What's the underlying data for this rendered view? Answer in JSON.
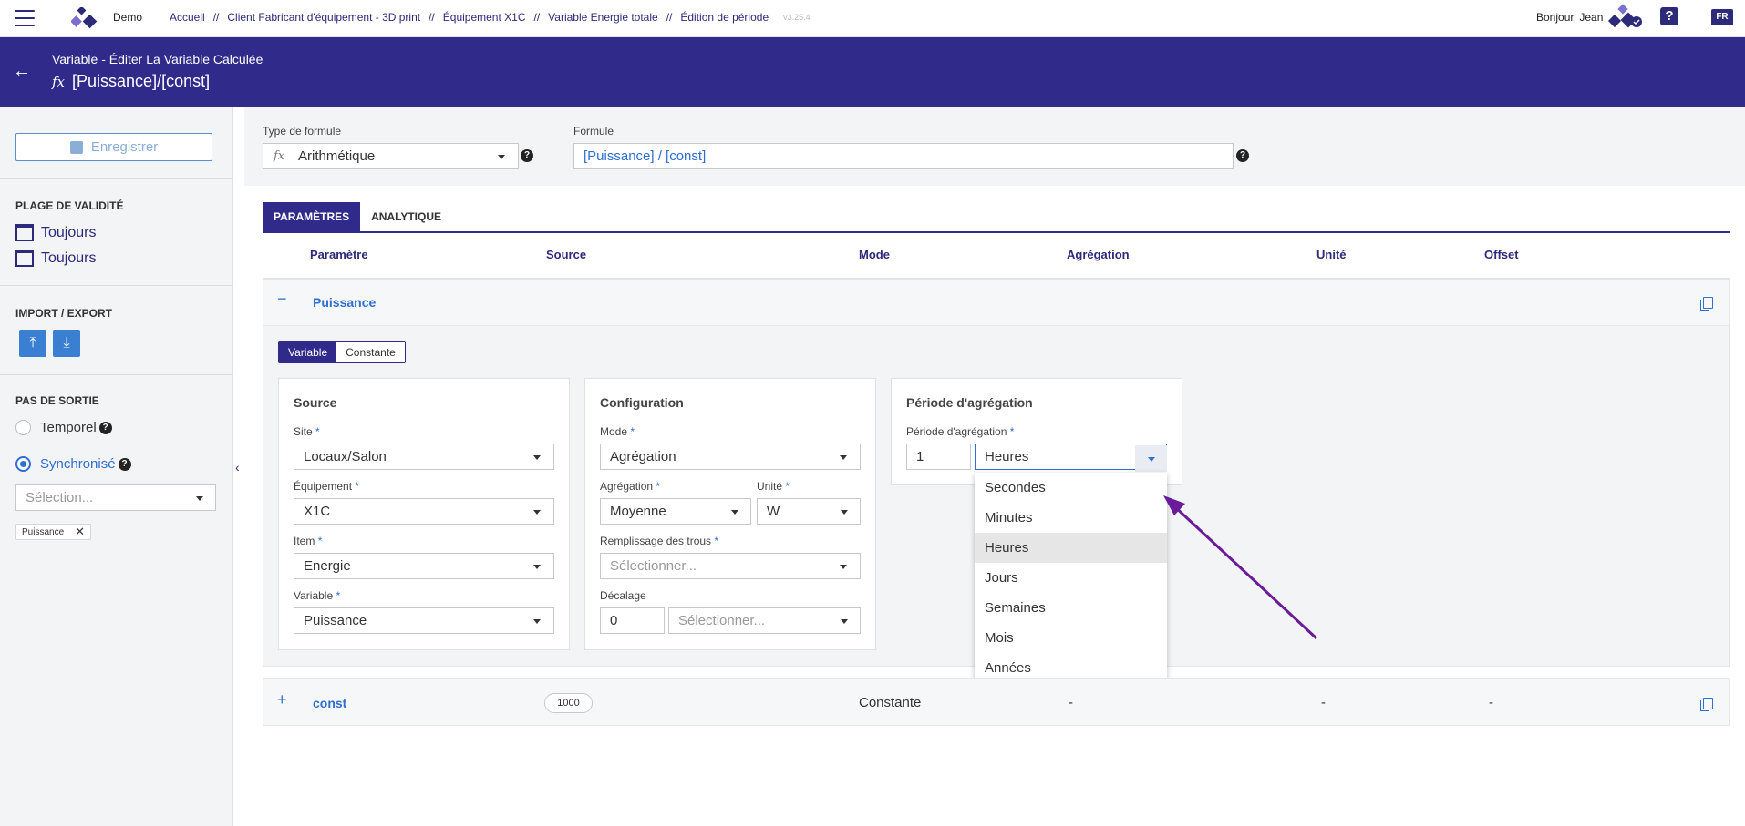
{
  "topbar": {
    "brand": "Demo",
    "breadcrumbs": [
      "Accueil",
      "Client Fabricant d'équipement - 3D print",
      "Équipement X1C",
      "Variable Energie totale",
      "Édition de période"
    ],
    "separator": "//",
    "version": "v3.25.4",
    "greeting": "Bonjour, Jean",
    "help": "?",
    "language": "FR"
  },
  "header": {
    "subtitle": "Variable - Éditer La Variable Calculée",
    "fx": "𝑓𝑥",
    "title": "[Puissance]/[const]"
  },
  "sidebar": {
    "save_label": "Enregistrer",
    "validity_title": "PLAGE DE VALIDITÉ",
    "validity_from": "Toujours",
    "validity_to": "Toujours",
    "import_export_title": "IMPORT / EXPORT",
    "output_step_title": "PAS DE SORTIE",
    "option_temporal": "Temporel",
    "option_sync": "Synchronisé",
    "select_placeholder": "Sélection...",
    "chip_label": "Puissance"
  },
  "formula": {
    "type_label": "Type de formule",
    "type_value": "Arithmétique",
    "formula_label": "Formule",
    "formula_value": "[Puissance] / [const]"
  },
  "tabs": [
    "PARAMÈTRES",
    "ANALYTIQUE"
  ],
  "columns": [
    "Paramètre",
    "Source",
    "Mode",
    "Agrégation",
    "Unité",
    "Offset"
  ],
  "param1": {
    "name": "Puissance",
    "collapse": "−",
    "toggle": [
      "Variable",
      "Constante"
    ],
    "source": {
      "title": "Source",
      "site_label": "Site",
      "site_value": "Locaux/Salon",
      "equip_label": "Équipement",
      "equip_value": "X1C",
      "item_label": "Item",
      "item_value": "Energie",
      "var_label": "Variable",
      "var_value": "Puissance"
    },
    "config": {
      "title": "Configuration",
      "mode_label": "Mode",
      "mode_value": "Agrégation",
      "agg_label": "Agrégation",
      "agg_value": "Moyenne",
      "unit_label": "Unité",
      "unit_value": "W",
      "fill_label": "Remplissage des trous",
      "fill_placeholder": "Sélectionner...",
      "offset_label": "Décalage",
      "offset_value": "0",
      "offset_unit_placeholder": "Sélectionner..."
    },
    "period": {
      "title": "Période d'agrégation",
      "label": "Période d'agrégation",
      "value": "1",
      "unit": "Heures",
      "options": [
        "Secondes",
        "Minutes",
        "Heures",
        "Jours",
        "Semaines",
        "Mois",
        "Années"
      ],
      "selected_index": 2
    }
  },
  "param2": {
    "expand": "+",
    "name": "const",
    "value": "1000",
    "mode": "Constante",
    "aggregation": "-",
    "unit": "-",
    "offset": "-"
  },
  "required_mark": "*",
  "colors": {
    "primary": "#302a8a",
    "accent": "#2f6fd0",
    "arrow": "#6a1b9a"
  }
}
